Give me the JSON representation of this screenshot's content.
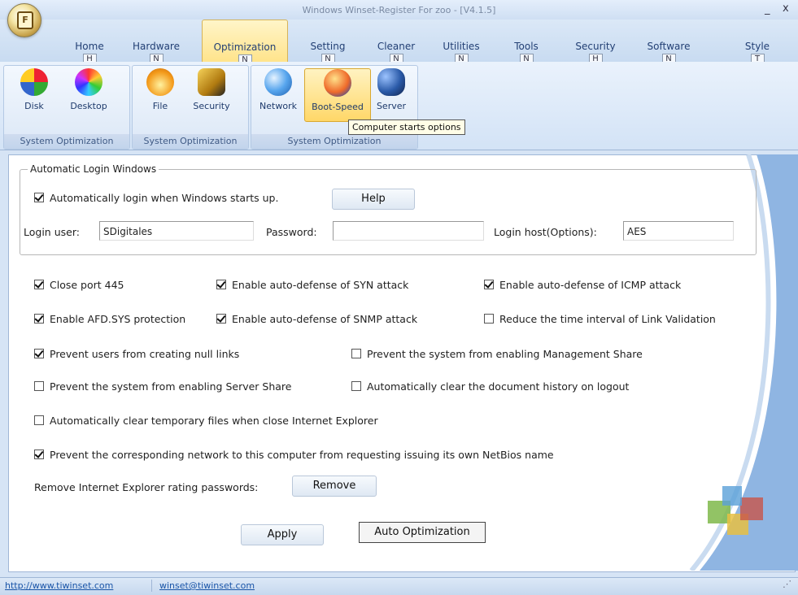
{
  "window": {
    "title": "Windows Winset-Register For zoo - [V4.1.5]",
    "app_key": "F",
    "minimize_glyph": "_",
    "close_glyph": "x"
  },
  "tabs": [
    {
      "label": "Home",
      "key": "H"
    },
    {
      "label": "Hardware",
      "key": "N"
    },
    {
      "label": "Optimization",
      "key": "N"
    },
    {
      "label": "Setting",
      "key": "N"
    },
    {
      "label": "Cleaner",
      "key": "N"
    },
    {
      "label": "Utilities",
      "key": "N"
    },
    {
      "label": "Tools",
      "key": "N"
    },
    {
      "label": "Security",
      "key": "H"
    },
    {
      "label": "Software",
      "key": "N"
    },
    {
      "label": "Style",
      "key": "T"
    }
  ],
  "ribbon": {
    "buttons": [
      {
        "label": "Disk",
        "icon": "disk-icon",
        "color": "#3aa63a"
      },
      {
        "label": "Desktop",
        "icon": "desktop-icon",
        "color": "#e8453c"
      },
      {
        "label": "File",
        "icon": "file-icon",
        "color": "#f0a020"
      },
      {
        "label": "Security",
        "icon": "security-icon",
        "color": "#c49a18"
      },
      {
        "label": "Network",
        "icon": "network-icon",
        "color": "#3a7ed6"
      },
      {
        "label": "Boot-Speed",
        "icon": "boot-speed-icon",
        "color": "#e0602a"
      },
      {
        "label": "Server",
        "icon": "server-icon",
        "color": "#2a5aa8"
      }
    ],
    "groups": [
      {
        "caption": "System Optimization"
      },
      {
        "caption": "System Optimization"
      },
      {
        "caption": "System Optimization"
      }
    ],
    "tooltip": "Computer starts options"
  },
  "login": {
    "legend": "Automatic Login Windows",
    "auto_login_label": "Automatically login when Windows starts up.",
    "auto_login_checked": true,
    "help_label": "Help",
    "user_label": "Login user:",
    "user_value": "SDigitales",
    "password_label": "Password:",
    "password_value": "",
    "host_label": "Login host(Options):",
    "host_value": "AES"
  },
  "options": [
    {
      "label": "Close port 445",
      "checked": true
    },
    {
      "label": "Enable auto-defense of SYN attack",
      "checked": true
    },
    {
      "label": "Enable auto-defense of ICMP attack",
      "checked": true
    },
    {
      "label": "Enable AFD.SYS protection",
      "checked": true
    },
    {
      "label": "Enable auto-defense of SNMP attack",
      "checked": true
    },
    {
      "label": "Reduce the time interval of Link Validation",
      "checked": false
    },
    {
      "label": "Prevent users from creating null links",
      "checked": true
    },
    {
      "label": "Prevent the system from enabling Management Share",
      "checked": false
    },
    {
      "label": "Prevent the system from enabling Server Share",
      "checked": false
    },
    {
      "label": "Automatically clear the document history on logout",
      "checked": false
    },
    {
      "label": "Automatically clear temporary files when close Internet Explorer",
      "checked": false
    },
    {
      "label": "Prevent the corresponding network to this computer from requesting issuing its own NetBios name",
      "checked": true
    }
  ],
  "ie_rating": {
    "label": "Remove Internet Explorer rating passwords:",
    "button": "Remove"
  },
  "actions": {
    "apply": "Apply",
    "auto_optimization": "Auto Optimization"
  },
  "status": {
    "website": "http://www.tiwinset.com",
    "email": "winset@tiwinset.com"
  }
}
